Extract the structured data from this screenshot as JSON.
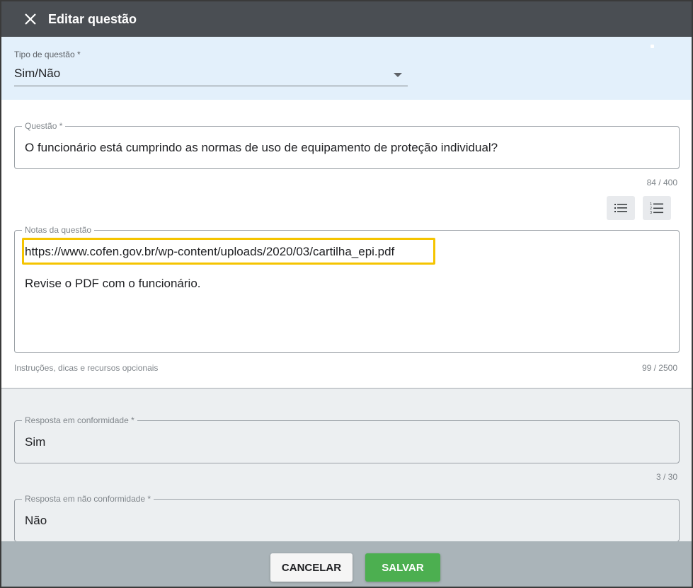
{
  "header": {
    "title": "Editar questão",
    "close_icon": "close-icon",
    "bg_color": "#4a4e53"
  },
  "question_type": {
    "label": "Tipo de questão *",
    "value": "Sim/Não",
    "bg_color": "#e3f0fb"
  },
  "question": {
    "label": "Questão *",
    "value": "O funcionário está cumprindo as normas de uso de equipamento de proteção individual?",
    "counter": "84 / 400"
  },
  "toolbar": {
    "bulleted_list_icon": "bulleted-list-icon",
    "numbered_list_icon": "numbered-list-icon"
  },
  "notes": {
    "label": "Notas da questão",
    "line1": "https://www.cofen.gov.br/wp-content/uploads/2020/03/cartilha_epi.pdf",
    "line2": "Revise o PDF com o funcionário.",
    "hint": "Instruções, dicas e recursos opcionais",
    "counter": "99 / 2500",
    "highlight_color": "#f5c400"
  },
  "compliant_answer": {
    "label": "Resposta em conformidade *",
    "value": "Sim",
    "counter": "3 / 30"
  },
  "non_compliant_answer": {
    "label": "Resposta em não conformidade *",
    "value": "Não"
  },
  "footer": {
    "cancel_label": "CANCELAR",
    "save_label": "SALVAR",
    "save_color": "#4caf50"
  }
}
